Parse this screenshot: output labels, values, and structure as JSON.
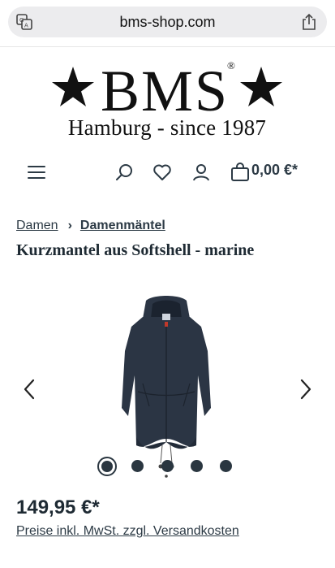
{
  "browser": {
    "url": "bms-shop.com"
  },
  "logo": {
    "main": "BMS",
    "registered": "®",
    "subtitle": "Hamburg - since 1987"
  },
  "header": {
    "cart_total": "0,00 €*"
  },
  "breadcrumb": {
    "items": [
      "Damen",
      "Damenmäntel"
    ],
    "separator": "›"
  },
  "product": {
    "title": "Kurzmantel aus Softshell - marine",
    "price": "149,95 €*",
    "price_note": "Preise inkl. MwSt. zzgl. Versandkosten",
    "image_count": 5,
    "active_image": 1,
    "color": "#2b3544"
  },
  "icons": [
    "translate-icon",
    "share-icon",
    "menu-icon",
    "search-icon",
    "heart-icon",
    "user-icon",
    "cart-icon",
    "chevron-left-icon",
    "chevron-right-icon"
  ]
}
